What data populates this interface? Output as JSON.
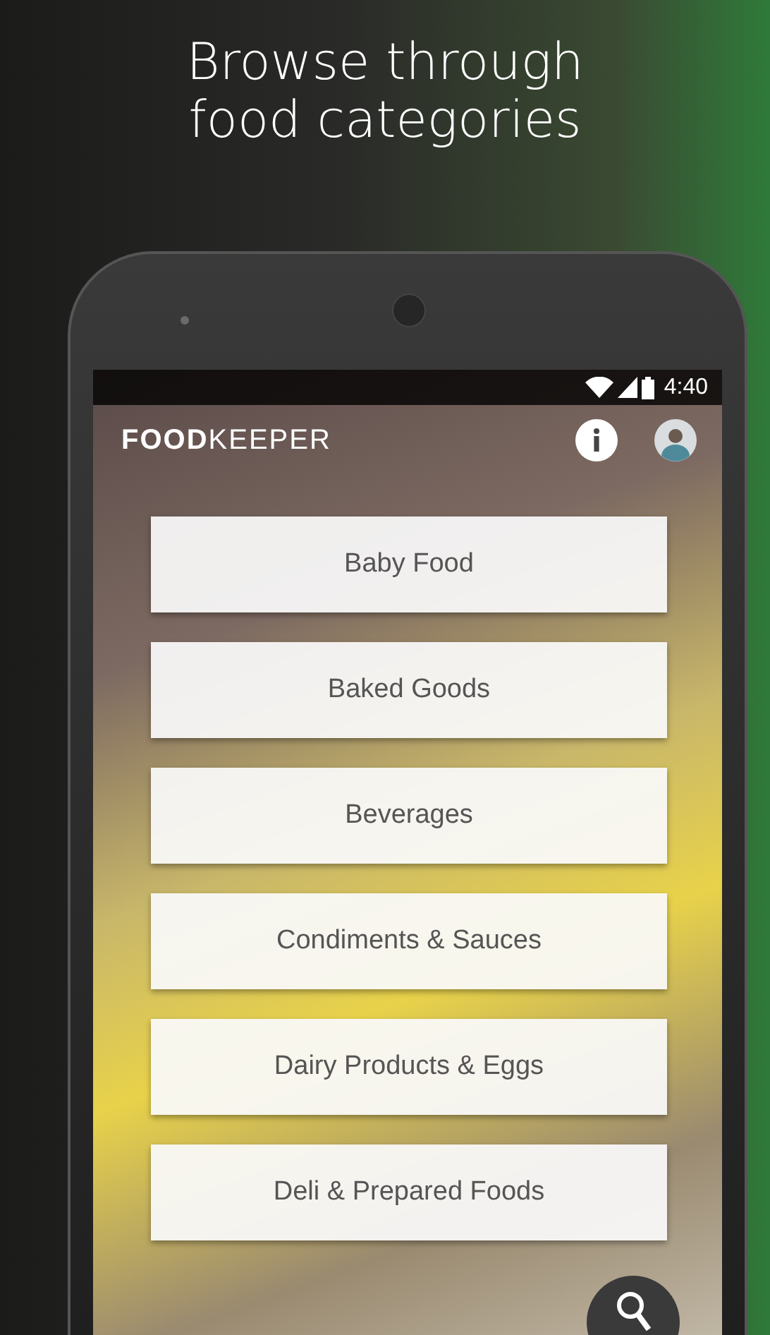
{
  "headline": "Browse through food categories",
  "status_bar": {
    "time": "4:40"
  },
  "app_bar": {
    "logo": "**FOOD**KEEPER"
  },
  "categories": [
    {
      "label": "Baby Food"
    },
    {
      "label": "Baked Goods"
    },
    {
      "label": "Beverages"
    },
    {
      "label": "Condiments & Sauces"
    },
    {
      "label": "Dairy Products & Eggs"
    },
    {
      "label": "Deli & Prepared Foods"
    }
  ]
}
